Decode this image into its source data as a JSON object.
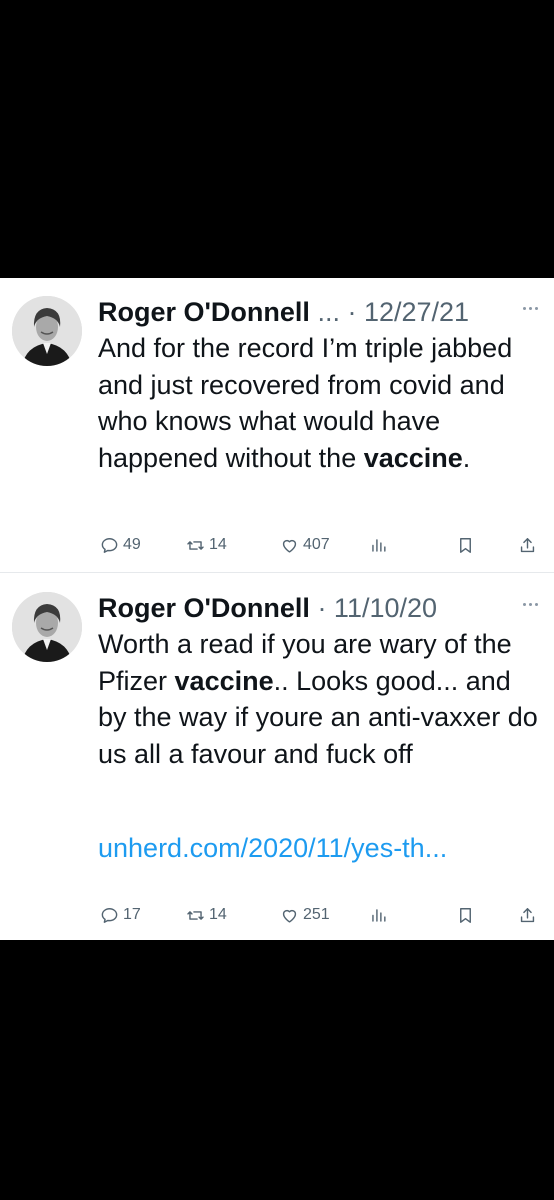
{
  "tweets": [
    {
      "name": "Roger O'Donnell",
      "meta": " ... · 12/27/21",
      "body": [
        {
          "text": "And for the record I’m triple jabbed and just recovered from covid and who knows what would have happened without the "
        },
        {
          "text": "vaccine",
          "bold": true
        },
        {
          "text": "."
        }
      ],
      "replies": "49",
      "retweets": "14",
      "likes": "407"
    },
    {
      "name": "Roger O'Donnell",
      "meta": " · 11/10/20",
      "body": [
        {
          "text": "Worth a read if you are wary of the Pfizer "
        },
        {
          "text": "vaccine",
          "bold": true
        },
        {
          "text": ".. Looks good... and by the way if youre an anti-vaxxer do us all a favour and fuck off"
        }
      ],
      "link": "unherd.com/2020/11/yes-th...",
      "replies": "17",
      "retweets": "14",
      "likes": "251"
    }
  ],
  "icons": {
    "reply": "reply-icon",
    "retweet": "retweet-icon",
    "like": "heart-icon",
    "views": "views-icon",
    "bookmark": "bookmark-icon",
    "share": "share-icon",
    "more": "more-icon"
  },
  "colors": {
    "background": "#000000",
    "card": "#ffffff",
    "text": "#0f1419",
    "secondary": "#536471",
    "link": "#1d9bf0"
  }
}
